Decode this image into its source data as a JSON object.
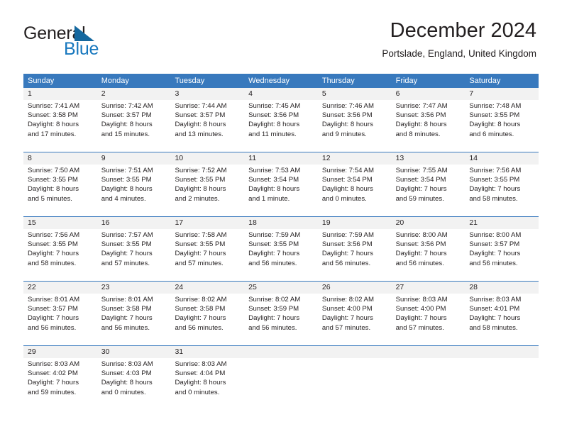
{
  "brand": {
    "name_part1": "General",
    "name_part2": "Blue",
    "triangle_icon": "blue-triangle-icon",
    "color_dark": "#231f20",
    "color_blue": "#1878be"
  },
  "header": {
    "title": "December 2024",
    "subtitle": "Portslade, England, United Kingdom"
  },
  "colors": {
    "header_row_bg": "#3879bd",
    "daynum_bg": "#f2f2f2",
    "text": "#231f20"
  },
  "weekdays": [
    "Sunday",
    "Monday",
    "Tuesday",
    "Wednesday",
    "Thursday",
    "Friday",
    "Saturday"
  ],
  "weeks": [
    {
      "days": [
        {
          "num": "1",
          "sunrise": "Sunrise: 7:41 AM",
          "sunset": "Sunset: 3:58 PM",
          "daylight1": "Daylight: 8 hours",
          "daylight2": "and 17 minutes."
        },
        {
          "num": "2",
          "sunrise": "Sunrise: 7:42 AM",
          "sunset": "Sunset: 3:57 PM",
          "daylight1": "Daylight: 8 hours",
          "daylight2": "and 15 minutes."
        },
        {
          "num": "3",
          "sunrise": "Sunrise: 7:44 AM",
          "sunset": "Sunset: 3:57 PM",
          "daylight1": "Daylight: 8 hours",
          "daylight2": "and 13 minutes."
        },
        {
          "num": "4",
          "sunrise": "Sunrise: 7:45 AM",
          "sunset": "Sunset: 3:56 PM",
          "daylight1": "Daylight: 8 hours",
          "daylight2": "and 11 minutes."
        },
        {
          "num": "5",
          "sunrise": "Sunrise: 7:46 AM",
          "sunset": "Sunset: 3:56 PM",
          "daylight1": "Daylight: 8 hours",
          "daylight2": "and 9 minutes."
        },
        {
          "num": "6",
          "sunrise": "Sunrise: 7:47 AM",
          "sunset": "Sunset: 3:56 PM",
          "daylight1": "Daylight: 8 hours",
          "daylight2": "and 8 minutes."
        },
        {
          "num": "7",
          "sunrise": "Sunrise: 7:48 AM",
          "sunset": "Sunset: 3:55 PM",
          "daylight1": "Daylight: 8 hours",
          "daylight2": "and 6 minutes."
        }
      ]
    },
    {
      "days": [
        {
          "num": "8",
          "sunrise": "Sunrise: 7:50 AM",
          "sunset": "Sunset: 3:55 PM",
          "daylight1": "Daylight: 8 hours",
          "daylight2": "and 5 minutes."
        },
        {
          "num": "9",
          "sunrise": "Sunrise: 7:51 AM",
          "sunset": "Sunset: 3:55 PM",
          "daylight1": "Daylight: 8 hours",
          "daylight2": "and 4 minutes."
        },
        {
          "num": "10",
          "sunrise": "Sunrise: 7:52 AM",
          "sunset": "Sunset: 3:55 PM",
          "daylight1": "Daylight: 8 hours",
          "daylight2": "and 2 minutes."
        },
        {
          "num": "11",
          "sunrise": "Sunrise: 7:53 AM",
          "sunset": "Sunset: 3:54 PM",
          "daylight1": "Daylight: 8 hours",
          "daylight2": "and 1 minute."
        },
        {
          "num": "12",
          "sunrise": "Sunrise: 7:54 AM",
          "sunset": "Sunset: 3:54 PM",
          "daylight1": "Daylight: 8 hours",
          "daylight2": "and 0 minutes."
        },
        {
          "num": "13",
          "sunrise": "Sunrise: 7:55 AM",
          "sunset": "Sunset: 3:54 PM",
          "daylight1": "Daylight: 7 hours",
          "daylight2": "and 59 minutes."
        },
        {
          "num": "14",
          "sunrise": "Sunrise: 7:56 AM",
          "sunset": "Sunset: 3:55 PM",
          "daylight1": "Daylight: 7 hours",
          "daylight2": "and 58 minutes."
        }
      ]
    },
    {
      "days": [
        {
          "num": "15",
          "sunrise": "Sunrise: 7:56 AM",
          "sunset": "Sunset: 3:55 PM",
          "daylight1": "Daylight: 7 hours",
          "daylight2": "and 58 minutes."
        },
        {
          "num": "16",
          "sunrise": "Sunrise: 7:57 AM",
          "sunset": "Sunset: 3:55 PM",
          "daylight1": "Daylight: 7 hours",
          "daylight2": "and 57 minutes."
        },
        {
          "num": "17",
          "sunrise": "Sunrise: 7:58 AM",
          "sunset": "Sunset: 3:55 PM",
          "daylight1": "Daylight: 7 hours",
          "daylight2": "and 57 minutes."
        },
        {
          "num": "18",
          "sunrise": "Sunrise: 7:59 AM",
          "sunset": "Sunset: 3:55 PM",
          "daylight1": "Daylight: 7 hours",
          "daylight2": "and 56 minutes."
        },
        {
          "num": "19",
          "sunrise": "Sunrise: 7:59 AM",
          "sunset": "Sunset: 3:56 PM",
          "daylight1": "Daylight: 7 hours",
          "daylight2": "and 56 minutes."
        },
        {
          "num": "20",
          "sunrise": "Sunrise: 8:00 AM",
          "sunset": "Sunset: 3:56 PM",
          "daylight1": "Daylight: 7 hours",
          "daylight2": "and 56 minutes."
        },
        {
          "num": "21",
          "sunrise": "Sunrise: 8:00 AM",
          "sunset": "Sunset: 3:57 PM",
          "daylight1": "Daylight: 7 hours",
          "daylight2": "and 56 minutes."
        }
      ]
    },
    {
      "days": [
        {
          "num": "22",
          "sunrise": "Sunrise: 8:01 AM",
          "sunset": "Sunset: 3:57 PM",
          "daylight1": "Daylight: 7 hours",
          "daylight2": "and 56 minutes."
        },
        {
          "num": "23",
          "sunrise": "Sunrise: 8:01 AM",
          "sunset": "Sunset: 3:58 PM",
          "daylight1": "Daylight: 7 hours",
          "daylight2": "and 56 minutes."
        },
        {
          "num": "24",
          "sunrise": "Sunrise: 8:02 AM",
          "sunset": "Sunset: 3:58 PM",
          "daylight1": "Daylight: 7 hours",
          "daylight2": "and 56 minutes."
        },
        {
          "num": "25",
          "sunrise": "Sunrise: 8:02 AM",
          "sunset": "Sunset: 3:59 PM",
          "daylight1": "Daylight: 7 hours",
          "daylight2": "and 56 minutes."
        },
        {
          "num": "26",
          "sunrise": "Sunrise: 8:02 AM",
          "sunset": "Sunset: 4:00 PM",
          "daylight1": "Daylight: 7 hours",
          "daylight2": "and 57 minutes."
        },
        {
          "num": "27",
          "sunrise": "Sunrise: 8:03 AM",
          "sunset": "Sunset: 4:00 PM",
          "daylight1": "Daylight: 7 hours",
          "daylight2": "and 57 minutes."
        },
        {
          "num": "28",
          "sunrise": "Sunrise: 8:03 AM",
          "sunset": "Sunset: 4:01 PM",
          "daylight1": "Daylight: 7 hours",
          "daylight2": "and 58 minutes."
        }
      ]
    },
    {
      "days": [
        {
          "num": "29",
          "sunrise": "Sunrise: 8:03 AM",
          "sunset": "Sunset: 4:02 PM",
          "daylight1": "Daylight: 7 hours",
          "daylight2": "and 59 minutes."
        },
        {
          "num": "30",
          "sunrise": "Sunrise: 8:03 AM",
          "sunset": "Sunset: 4:03 PM",
          "daylight1": "Daylight: 8 hours",
          "daylight2": "and 0 minutes."
        },
        {
          "num": "31",
          "sunrise": "Sunrise: 8:03 AM",
          "sunset": "Sunset: 4:04 PM",
          "daylight1": "Daylight: 8 hours",
          "daylight2": "and 0 minutes."
        },
        {
          "num": "",
          "sunrise": "",
          "sunset": "",
          "daylight1": "",
          "daylight2": ""
        },
        {
          "num": "",
          "sunrise": "",
          "sunset": "",
          "daylight1": "",
          "daylight2": ""
        },
        {
          "num": "",
          "sunrise": "",
          "sunset": "",
          "daylight1": "",
          "daylight2": ""
        },
        {
          "num": "",
          "sunrise": "",
          "sunset": "",
          "daylight1": "",
          "daylight2": ""
        }
      ]
    }
  ]
}
